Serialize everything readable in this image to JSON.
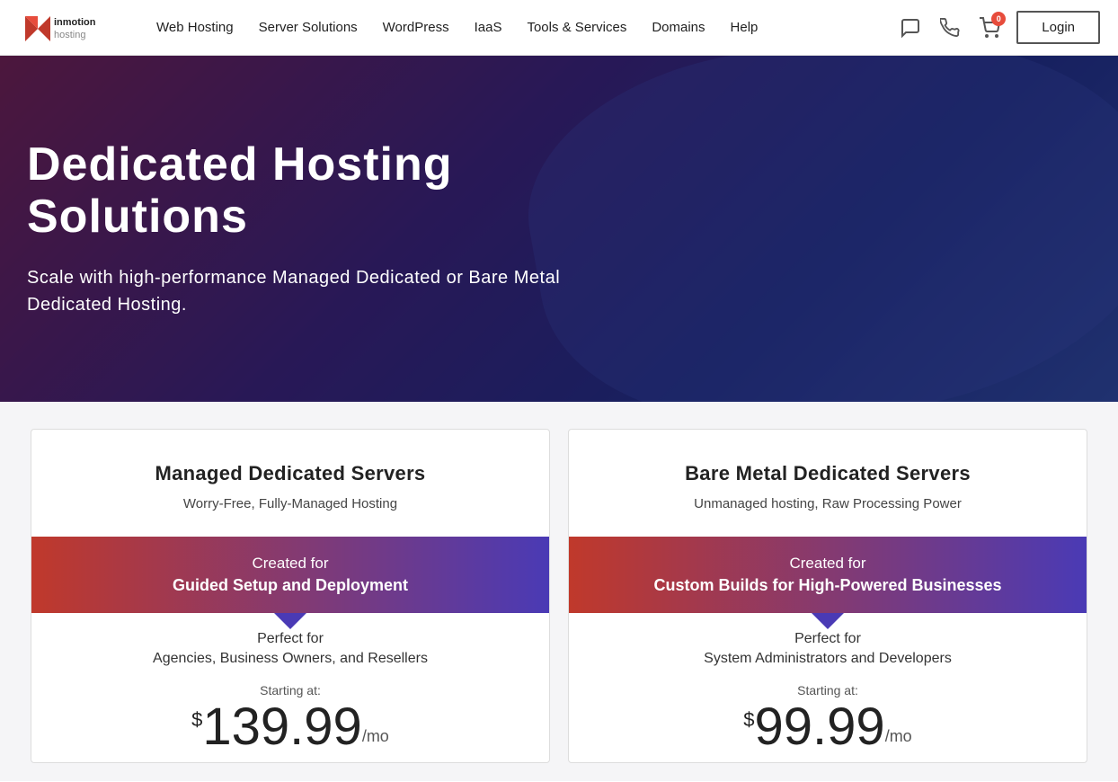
{
  "navbar": {
    "logo_alt": "InMotion Hosting",
    "links": [
      {
        "label": "Web Hosting",
        "id": "web-hosting"
      },
      {
        "label": "Server Solutions",
        "id": "server-solutions"
      },
      {
        "label": "WordPress",
        "id": "wordpress"
      },
      {
        "label": "IaaS",
        "id": "iaas"
      },
      {
        "label": "Tools & Services",
        "id": "tools-services"
      },
      {
        "label": "Domains",
        "id": "domains"
      },
      {
        "label": "Help",
        "id": "help"
      }
    ],
    "cart_count": "0",
    "login_label": "Login"
  },
  "hero": {
    "title": "Dedicated Hosting Solutions",
    "subtitle": "Scale with high-performance Managed Dedicated or Bare Metal Dedicated Hosting."
  },
  "cards": [
    {
      "id": "managed",
      "title": "Managed Dedicated Servers",
      "subtitle": "Worry-Free, Fully-Managed Hosting",
      "banner_top": "Created for",
      "banner_bottom": "Guided Setup and Deployment",
      "perfect_for_label": "Perfect for",
      "perfect_for_value": "Agencies, Business Owners, and Resellers",
      "starting_at": "Starting at:",
      "price_dollar": "$",
      "price_amount": "139.99",
      "price_mo": "/mo"
    },
    {
      "id": "bare-metal",
      "title": "Bare Metal Dedicated Servers",
      "subtitle": "Unmanaged hosting, Raw Processing Power",
      "banner_top": "Created for",
      "banner_bottom": "Custom Builds for High-Powered Businesses",
      "perfect_for_label": "Perfect for",
      "perfect_for_value": "System Administrators and Developers",
      "starting_at": "Starting at:",
      "price_dollar": "$",
      "price_amount": "99.99",
      "price_mo": "/mo"
    }
  ]
}
